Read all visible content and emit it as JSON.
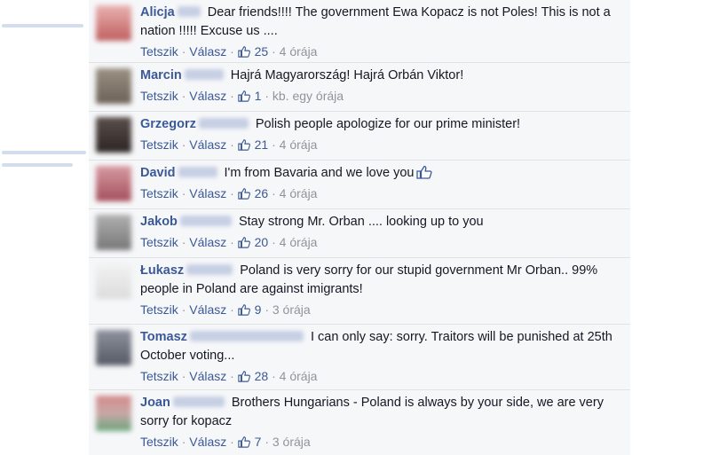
{
  "comments": [
    {
      "name": "Alicja",
      "text": "Dear friends!!!! The government Ewa Kopacz is not Poles! This is not a nation !!!!! Excuse us ....",
      "like_label": "Tetszik",
      "reply_label": "Válasz",
      "likes": "25",
      "time": "4 órája",
      "avatar_color": "#d08a8a"
    },
    {
      "name": "Marcin",
      "text": "Hajrá Magyarország! Hajrá Orbán Viktor!",
      "like_label": "Tetszik",
      "reply_label": "Válasz",
      "likes": "1",
      "time": "kb. egy órája",
      "avatar_color": "#7d7468"
    },
    {
      "name": "Grzegorz",
      "text": "Polish people apologize for our prime minister!",
      "like_label": "Tetszik",
      "reply_label": "Válasz",
      "likes": "21",
      "time": "4 órája",
      "avatar_color": "#3f3633"
    },
    {
      "name": "David",
      "text": "I'm from Bavaria and we love you",
      "like_label": "Tetszik",
      "reply_label": "Válasz",
      "likes": "26",
      "time": "4 órája",
      "avatar_color": "#b86a76"
    },
    {
      "name": "Jakob",
      "text": "Stay strong Mr. Orban .... looking up to you",
      "like_label": "Tetszik",
      "reply_label": "Válasz",
      "likes": "20",
      "time": "4 órája",
      "avatar_color": "#8e8e8e"
    },
    {
      "name": "Łukasz",
      "text": "Poland is very sorry for our stupid government Mr Orban.. 99% people in Poland are against imigrants!",
      "like_label": "Tetszik",
      "reply_label": "Válasz",
      "likes": "9",
      "time": "3 órája",
      "avatar_color": "#e6e6e6"
    },
    {
      "name": "Tomasz",
      "text": "I can only say: sorry. Traitors will be punished at 25th October voting...",
      "like_label": "Tetszik",
      "reply_label": "Válasz",
      "likes": "28",
      "time": "4 órája",
      "avatar_color": "#6a6e7a"
    },
    {
      "name": "Joan",
      "text": "Brothers Hungarians - Poland is always by your side, we are very sorry for kopacz",
      "like_label": "Tetszik",
      "reply_label": "Válasz",
      "likes": "7",
      "time": "3 órája",
      "avatar_color": "#9f6f72"
    }
  ],
  "colors": {
    "link": "#3b5998",
    "meta": "#8f949a",
    "background": "#f6f7f9"
  }
}
